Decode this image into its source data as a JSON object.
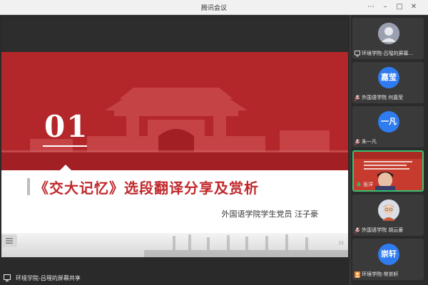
{
  "window": {
    "title": "腾讯会议"
  },
  "slide": {
    "section_number": "01",
    "title": "《交大记忆》选段翻译分享及赏析",
    "subtitle": "外国语学院学生党员 汪子豪",
    "page_marker": "15"
  },
  "share_label": "环境学院-吕瑆的屏幕共享",
  "participants": [
    {
      "name": "环境学院-吕瑆的屏幕...",
      "avatar_text": "",
      "avatar_type": "photo"
    },
    {
      "name": "外国语学院 何嘉莹",
      "avatar_text": "嘉莹",
      "avatar_type": "initials"
    },
    {
      "name": "朱一凡",
      "avatar_text": "一凡",
      "avatar_type": "initials"
    },
    {
      "name": "张洋",
      "avatar_text": "",
      "avatar_type": "video"
    },
    {
      "name": "外国语学院 胡云豪",
      "avatar_text": "",
      "avatar_type": "photo"
    },
    {
      "name": "环境学院-常崇轩",
      "avatar_text": "崇轩",
      "avatar_type": "initials"
    }
  ],
  "colors": {
    "accent": "#b3262a",
    "avatar_blue": "#2f7bf0",
    "speaking_green": "#38c172"
  }
}
